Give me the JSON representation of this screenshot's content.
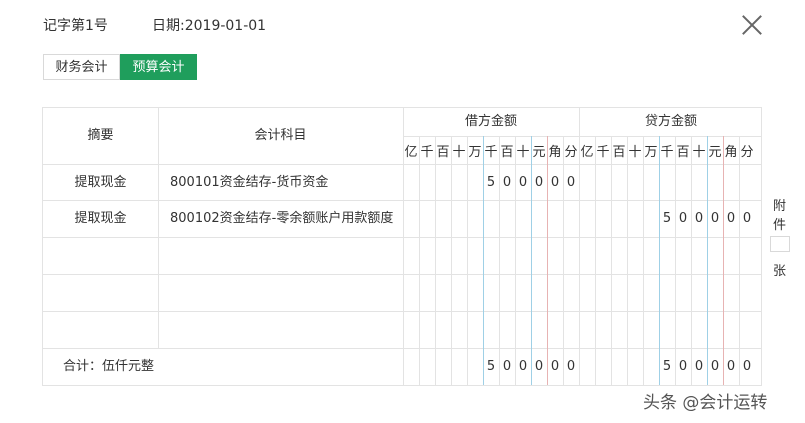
{
  "header": {
    "voucher_no": "记字第1号",
    "date": "日期:2019-01-01"
  },
  "tabs": [
    {
      "label": "财务会计"
    },
    {
      "label": "预算会计"
    }
  ],
  "table": {
    "col_summary": "摘要",
    "col_account": "会计科目",
    "col_debit": "借方金额",
    "col_credit": "贷方金额",
    "digit_units": [
      "亿",
      "千",
      "百",
      "十",
      "万",
      "千",
      "百",
      "十",
      "元",
      "角",
      "分"
    ],
    "rows": [
      {
        "summary": "提取现金",
        "account": "800101资金结存-货币资金",
        "debit": "500000",
        "credit": ""
      },
      {
        "summary": "提取现金",
        "account": "800102资金结存-零余额账户用款额度",
        "debit": "",
        "credit": "500000"
      },
      {
        "summary": "",
        "account": "",
        "debit": "",
        "credit": ""
      },
      {
        "summary": "",
        "account": "",
        "debit": "",
        "credit": ""
      },
      {
        "summary": "",
        "account": "",
        "debit": "",
        "credit": ""
      }
    ],
    "total_label": "合计：伍仟元整",
    "total_debit": "500000",
    "total_credit": "500000"
  },
  "attachments": {
    "label_top_1": "附",
    "label_top_2": "件",
    "label_bottom": "张",
    "count": ""
  },
  "watermark": "头条 @会计运转"
}
